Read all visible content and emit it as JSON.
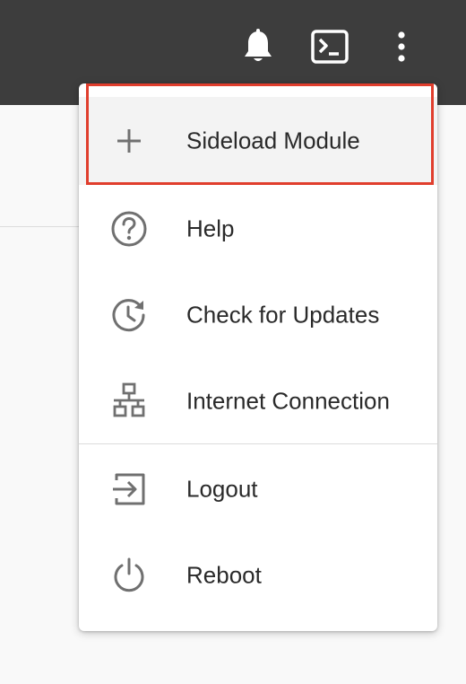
{
  "topbar": {
    "icons": [
      "bell-icon",
      "terminal-icon",
      "more-vertical-icon"
    ]
  },
  "menu": {
    "items": [
      {
        "label": "Sideload Module",
        "icon": "plus-icon",
        "highlighted": true
      },
      {
        "label": "Help",
        "icon": "help-circle-icon"
      },
      {
        "label": "Check for Updates",
        "icon": "update-clock-icon"
      },
      {
        "label": "Internet Connection",
        "icon": "network-icon"
      },
      {
        "label": "Logout",
        "icon": "logout-icon"
      },
      {
        "label": "Reboot",
        "icon": "power-icon"
      }
    ]
  },
  "colors": {
    "topbar": "#3d3d3d",
    "highlight_outline": "#e03e2d",
    "menu_background": "#ffffff",
    "icon_gray": "#707070"
  }
}
